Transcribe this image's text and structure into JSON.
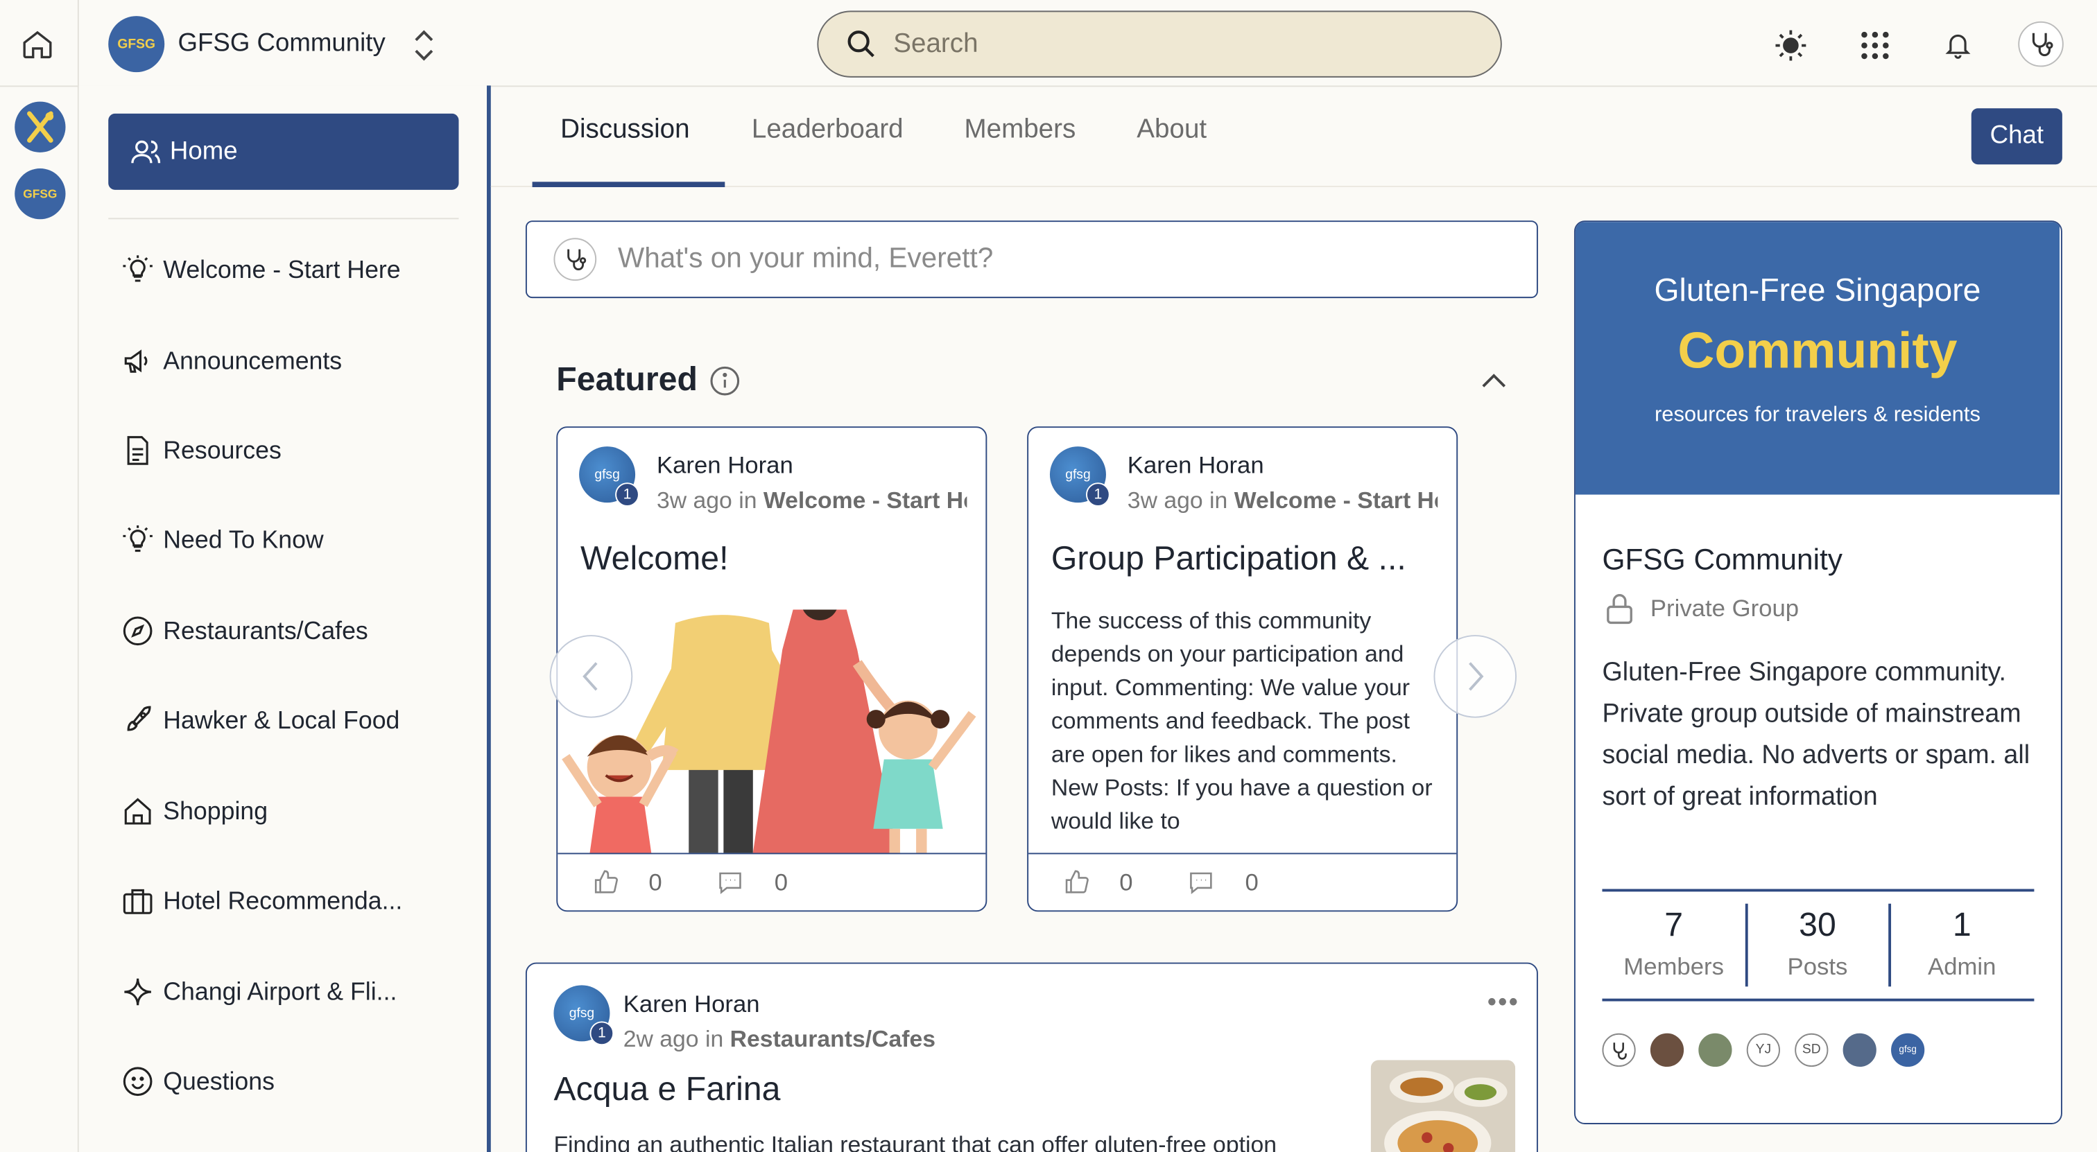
{
  "community": {
    "name": "GFSG Community",
    "logo_text": "GFSG"
  },
  "search": {
    "placeholder": "Search"
  },
  "sidebar": {
    "home_label": "Home",
    "items": [
      {
        "label": "Welcome - Start Here",
        "icon": "lightbulb-icon"
      },
      {
        "label": "Announcements",
        "icon": "megaphone-icon"
      },
      {
        "label": "Resources",
        "icon": "document-icon"
      },
      {
        "label": "Need To Know",
        "icon": "lightbulb-icon"
      },
      {
        "label": "Restaurants/Cafes",
        "icon": "compass-icon"
      },
      {
        "label": "Hawker & Local Food",
        "icon": "rocket-icon"
      },
      {
        "label": "Shopping",
        "icon": "house-icon"
      },
      {
        "label": "Hotel Recommenda...",
        "icon": "luggage-icon"
      },
      {
        "label": "Changi Airport & Fli...",
        "icon": "sparkle-icon"
      },
      {
        "label": "Questions",
        "icon": "smiley-icon"
      }
    ]
  },
  "tabs": [
    {
      "label": "Discussion",
      "active": true
    },
    {
      "label": "Leaderboard"
    },
    {
      "label": "Members"
    },
    {
      "label": "About"
    }
  ],
  "chat_label": "Chat",
  "composer": {
    "placeholder": "What's on your mind, Everett?"
  },
  "featured": {
    "title": "Featured",
    "posts": [
      {
        "author": "Karen Horan",
        "time": "3w ago",
        "in_word": "in",
        "space": "Welcome - Start Here",
        "title": "Welcome!",
        "likes": "0",
        "comments": "0",
        "avatar_text": "gfsg",
        "badge": "1"
      },
      {
        "author": "Karen Horan",
        "time": "3w ago",
        "in_word": "in",
        "space": "Welcome - Start Here",
        "title": "Group Participation & ...",
        "body": "The success of this community depends on your participation and input. Commenting: We value your comments and feedback. The post are open for likes and comments. New Posts: If you have a question or would like to",
        "likes": "0",
        "comments": "0",
        "avatar_text": "gfsg",
        "badge": "1"
      }
    ]
  },
  "feed_post": {
    "author": "Karen Horan",
    "time": "2w ago",
    "in_word": "in",
    "space": "Restaurants/Cafes",
    "title": "Acqua e Farina",
    "body": "Finding an authentic Italian restaurant that can offer gluten-free option",
    "avatar_text": "gfsg",
    "badge": "1"
  },
  "about": {
    "banner_line1": "Gluten-Free Singapore",
    "banner_line2": "Community",
    "banner_line3": "resources for travelers & residents",
    "name": "GFSG Community",
    "privacy": "Private Group",
    "description": "Gluten-Free Singapore community. Private group outside of mainstream social media. No adverts or spam. all sort of great information",
    "stats": [
      {
        "value": "7",
        "label": "Members"
      },
      {
        "value": "30",
        "label": "Posts"
      },
      {
        "value": "1",
        "label": "Admin"
      }
    ],
    "member_avatars": [
      "",
      "",
      "",
      "YJ",
      "SD",
      "",
      "gfsg"
    ]
  },
  "colors": {
    "primary": "#2f4a82",
    "banner": "#3c69a8",
    "accent": "#f3cf4a",
    "background": "#fbfaf6",
    "search_bg": "#efe8d3"
  }
}
